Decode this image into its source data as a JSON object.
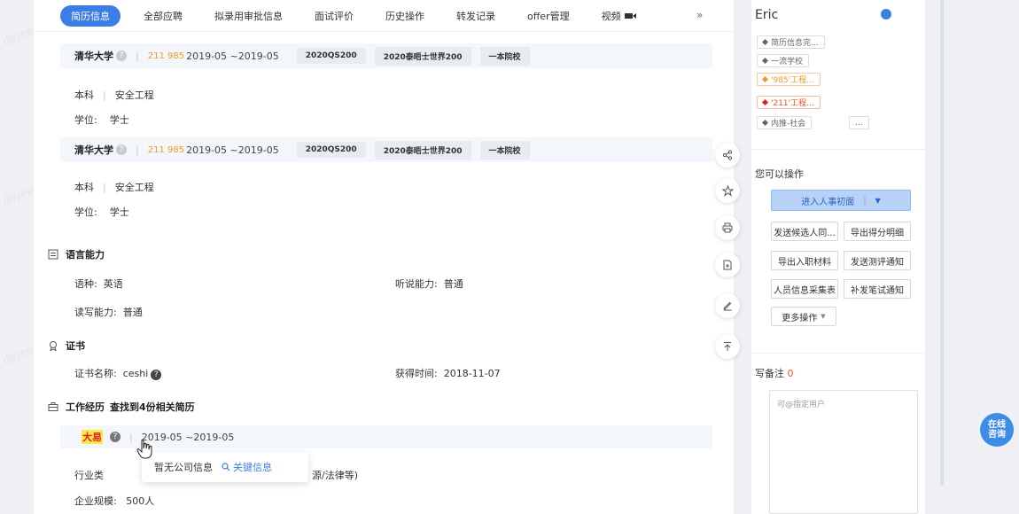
{
  "tabs": [
    {
      "label": "简历信息",
      "active": true
    },
    {
      "label": "全部应聘"
    },
    {
      "label": "拟录用审批信息"
    },
    {
      "label": "面试评价"
    },
    {
      "label": "历史操作"
    },
    {
      "label": "转发记录"
    },
    {
      "label": "offer管理"
    },
    {
      "label": "视频"
    }
  ],
  "tabs_more": "»",
  "education": [
    {
      "school": "清华大学",
      "tags": "211 985",
      "period": "2019-05 ~2019-05",
      "chips": [
        "2020QS200",
        "2020泰晤士世界200",
        "一本院校"
      ],
      "degree_level": "本科",
      "major": "安全工程",
      "degree_label": "学位:",
      "degree_value": "学士"
    },
    {
      "school": "清华大学",
      "tags": "211 985",
      "period": "2019-05 ~2019-05",
      "chips": [
        "2020QS200",
        "2020泰晤士世界200",
        "一本院校"
      ],
      "degree_level": "本科",
      "major": "安全工程",
      "degree_label": "学位:",
      "degree_value": "学士"
    }
  ],
  "language": {
    "title": "语言能力",
    "lang_label": "语种:",
    "lang_value": "英语",
    "listen_label": "听说能力:",
    "listen_value": "普通",
    "rw_label": "读写能力:",
    "rw_value": "普通"
  },
  "certificate": {
    "title": "证书",
    "name_label": "证书名称:",
    "name_value": "ceshi",
    "time_label": "获得时间:",
    "time_value": "2018-11-07"
  },
  "work": {
    "title": "工作经历",
    "related": "查找到4份相关简历",
    "company": "大易",
    "period": "2019-05 ~2019-05",
    "industry_label": "行业类",
    "industry_tail": "源/法律等)",
    "scale_label": "企业规模:",
    "scale_value": "500人",
    "tooltip_text": "暂无公司信息",
    "tooltip_link": "关键信息"
  },
  "sidebar": {
    "name": "Eric",
    "tags": [
      {
        "label": "简历信息完...",
        "color": "gray"
      },
      {
        "label": "一流学校",
        "color": "gray"
      },
      {
        "label": "'985'工程...",
        "color": "orange"
      },
      {
        "label": "'211'工程...",
        "color": "red"
      },
      {
        "label": "内推-社会",
        "color": "gray"
      }
    ],
    "tags_more": "...",
    "actions_title": "您可以操作",
    "primary_action": "进入人事初面",
    "actions": [
      "发送候选人同...",
      "导出得分明细",
      "导出入职材料",
      "发送测评通知",
      "人员信息采集表",
      "补发笔试通知"
    ],
    "more_actions": "更多操作",
    "note_title": "写备注",
    "note_count": "0",
    "note_placeholder": "可@指定用户"
  },
  "watermark": "dayeepm superda",
  "consult": {
    "line1": "在线",
    "line2": "咨询"
  },
  "colors": {
    "accent": "#3d7de6",
    "orange": "#f29a1f",
    "highlight": "#ffe94a"
  }
}
